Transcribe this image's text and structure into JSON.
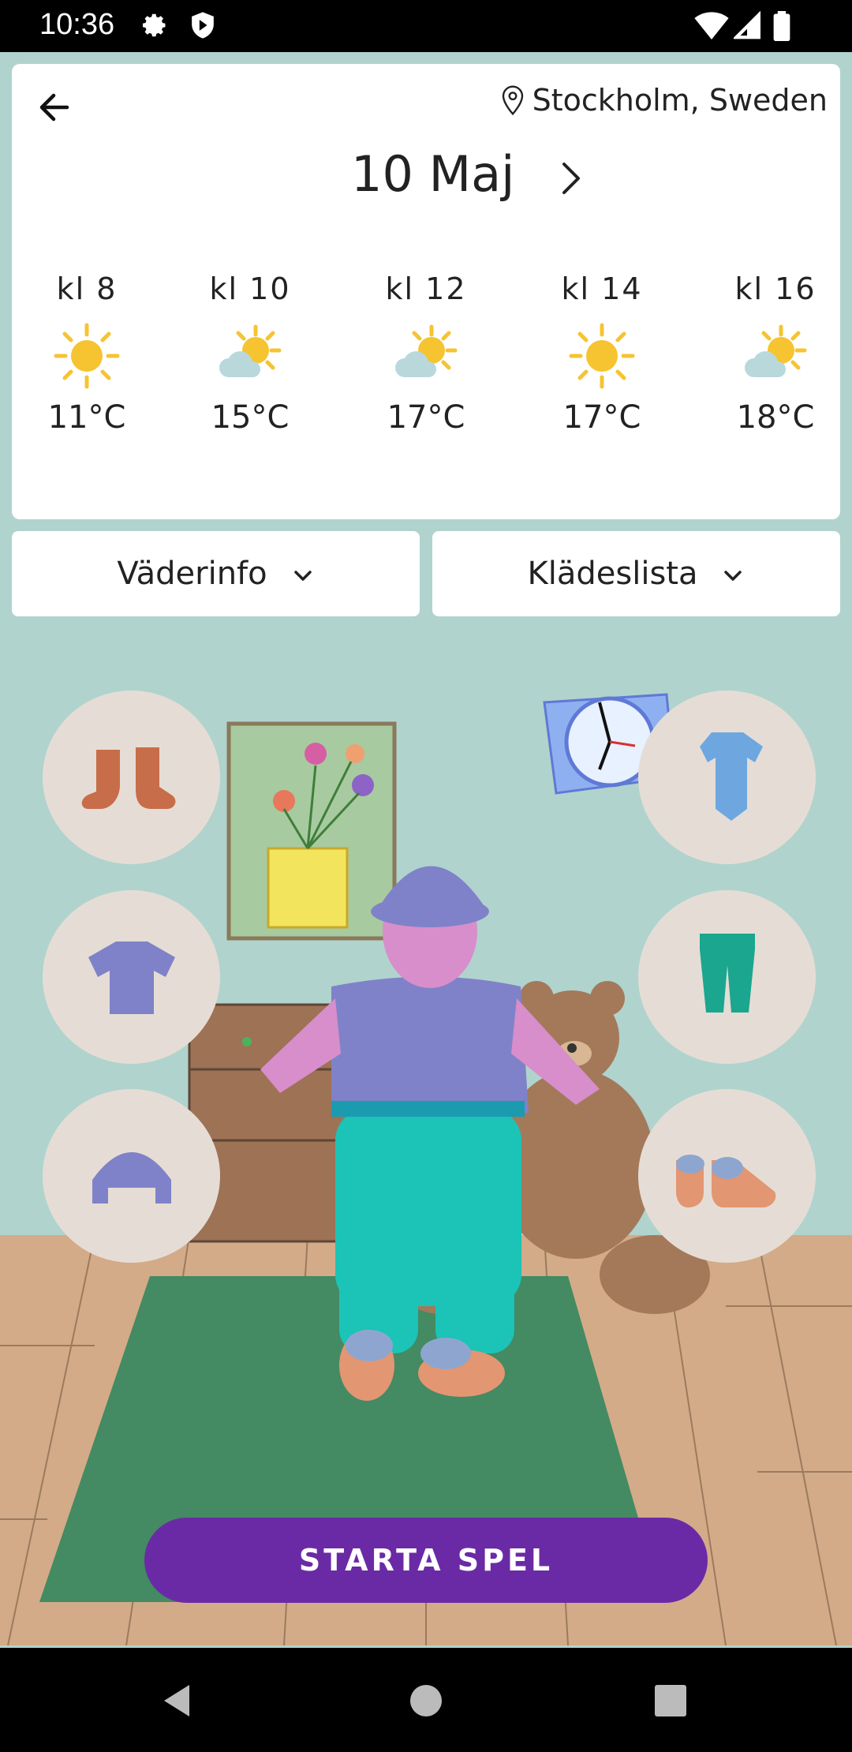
{
  "status_bar": {
    "time": "10:36"
  },
  "header": {
    "location": "Stockholm, Sweden",
    "date": "10 Maj"
  },
  "forecast": [
    {
      "hour": "kl 8",
      "temp": "11°C",
      "icon": "sun-icon"
    },
    {
      "hour": "kl 10",
      "temp": "15°C",
      "icon": "partly-cloudy-icon"
    },
    {
      "hour": "kl 12",
      "temp": "17°C",
      "icon": "partly-cloudy-icon"
    },
    {
      "hour": "kl 14",
      "temp": "17°C",
      "icon": "sun-icon"
    },
    {
      "hour": "kl 16",
      "temp": "18°C",
      "icon": "partly-cloudy-icon"
    }
  ],
  "dropdowns": {
    "weather_info": "Väderinfo",
    "clothes_list": "Klädeslista"
  },
  "clothing_options": {
    "left": [
      "socks-icon",
      "tshirt-icon",
      "cap-icon"
    ],
    "right": [
      "bodysuit-icon",
      "pants-icon",
      "shoes-icon"
    ]
  },
  "start_button": "STARTA SPEL",
  "colors": {
    "accent": "#6a2aa6",
    "background": "#b0d3cd",
    "sun": "#f6c431"
  }
}
